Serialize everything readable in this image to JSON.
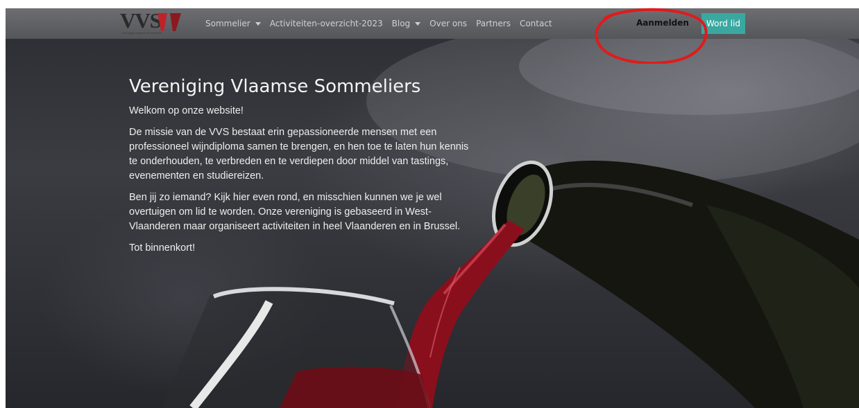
{
  "brand": {
    "logo_text": "VVS",
    "logo_subtitle": "Vereniging Vlaamse Sommeliers",
    "logo_mark_colors": [
      "#c0222a",
      "#8a1a1f"
    ]
  },
  "nav": {
    "items": [
      {
        "label": "Sommelier",
        "has_dropdown": true
      },
      {
        "label": "Activiteiten-overzicht-2023",
        "has_dropdown": false
      },
      {
        "label": "Blog",
        "has_dropdown": true
      },
      {
        "label": "Over ons",
        "has_dropdown": false
      },
      {
        "label": "Partners",
        "has_dropdown": false
      },
      {
        "label": "Contact",
        "has_dropdown": false
      }
    ],
    "login_label": "Aanmelden",
    "join_label": "Word lid"
  },
  "hero": {
    "title": "Vereniging Vlaamse Sommeliers",
    "paragraphs": [
      "Welkom op onze website!",
      "De missie van de VVS bestaat erin gepassioneerde mensen met een professioneel wijndiploma samen te brengen, en hen toe te laten hun kennis te onderhouden, te verbreden en te verdiepen door middel van tastings, evenementen en studiereizen.",
      "Ben jij zo iemand? Kijk hier even rond, en misschien kunnen we je wel overtuigen om lid te worden. Onze vereniging is gebaseerd in West-Vlaanderen maar organiseert activiteiten in heel Vlaanderen en in Brussel.",
      "Tot binnenkort!"
    ]
  },
  "colors": {
    "accent": "#3aa8a0",
    "annotation": "#e01b1b",
    "wine": "#8a0f1c"
  }
}
